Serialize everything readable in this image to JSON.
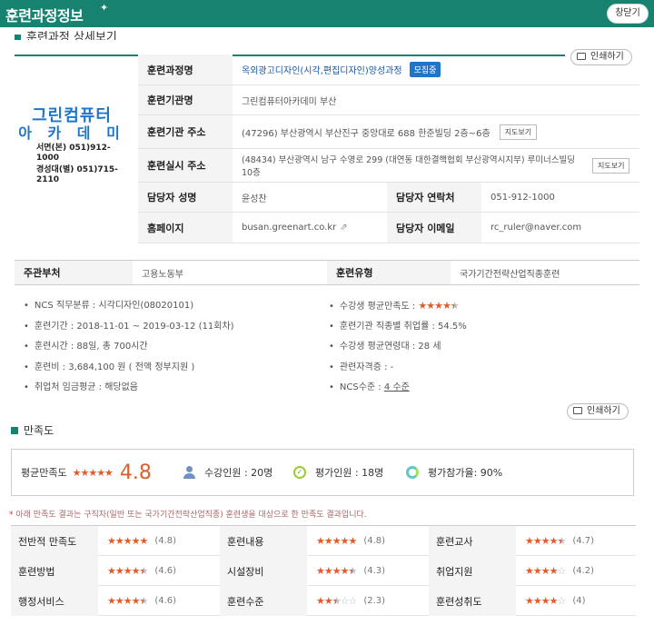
{
  "header": {
    "title": "훈련과정정보",
    "close_label": "창닫기"
  },
  "subheading": "훈련과정 상세보기",
  "print_label": "인쇄하기",
  "institution_logo": {
    "name_line1": "그린컴퓨터",
    "name_line2": "아 카 데 미",
    "phone1": "서면(본) 051)912-1000",
    "phone2": "경성대(별) 051)715-2110"
  },
  "details": {
    "course_name_label": "훈련과정명",
    "course_name": "옥외광고디자인(시각,편집디자인)양성과정",
    "status_badge": "모집중",
    "institution_label": "훈련기관명",
    "institution": "그린컴퓨터아카데미 부산",
    "inst_address_label": "훈련기관 주소",
    "inst_address": "(47296) 부산광역시 부산진구 중앙대로 688 한준빌딩 2층~6층",
    "map_label": "지도보기",
    "site_address_label": "훈련실시 주소",
    "site_address": "(48434) 부산광역시 남구 수영로 299 (대연동 대한결핵협회 부산광역시지부) 루미너스빌딩 10층",
    "manager_label": "담당자 성명",
    "manager": "윤성찬",
    "contact_label": "담당자 연락처",
    "contact": "051-912-1000",
    "homepage_label": "홈페이지",
    "homepage": "busan.greenart.co.kr",
    "email_label": "담당자 이메일",
    "email": "rc_ruler@naver.com"
  },
  "summary_row": {
    "ministry_label": "주관부처",
    "ministry": "고용노동부",
    "type_label": "훈련유형",
    "type": "국가기간전략산업직종훈련"
  },
  "info_left": [
    {
      "text": "NCS 직무분류 : 시각디자인(08020101)"
    },
    {
      "text": "훈련기간 : 2018-11-01 ~ 2019-03-12 (11회차)"
    },
    {
      "text": "훈련시간 : 88일, 총 700시간"
    },
    {
      "text": "훈련비 : 3,684,100 원 ( 전액 정부지원 )"
    },
    {
      "text": "취업처 임금평균 : 해당없음"
    }
  ],
  "info_right": {
    "rating_label": "수강생 평균만족도 :",
    "rating_stars": 4.5,
    "employment": "훈련기관 직종별 취업률 : 54.5%",
    "age": "수강생 평균연령대 : 28 세",
    "cert": "관련자격증 : -",
    "ncs_label": "NCS수준 : ",
    "ncs_link": "4 수준"
  },
  "satisfaction": {
    "title": "만족도",
    "avg_label": "평균만족도",
    "avg_score": "4.8",
    "avg_stars": 4.8,
    "enrolled": "수강인원 : 20명",
    "raters": "평가인원 : 18명",
    "participation": "평가참가율: 90%",
    "note": "아래 만족도 결과는 구직자(일반 또는 국가기간전략산업직종) 훈련생을 대상으로 한 만족도 결과입니다.",
    "note_mark": "*",
    "rows": [
      [
        {
          "label": "전반적 만족도",
          "stars": 4.8,
          "value": "(4.8)"
        },
        {
          "label": "훈련내용",
          "stars": 4.8,
          "value": "(4.8)"
        },
        {
          "label": "훈련교사",
          "stars": 4.7,
          "value": "(4.7)"
        }
      ],
      [
        {
          "label": "훈련방법",
          "stars": 4.6,
          "value": "(4.6)"
        },
        {
          "label": "시설장비",
          "stars": 4.3,
          "value": "(4.3)"
        },
        {
          "label": "취업지원",
          "stars": 4.2,
          "value": "(4.2)"
        }
      ],
      [
        {
          "label": "행정서비스",
          "stars": 4.6,
          "value": "(4.6)"
        },
        {
          "label": "훈련수준",
          "stars": 2.3,
          "value": "(2.3)"
        },
        {
          "label": "훈련성취도",
          "stars": 4,
          "value": "(4)"
        }
      ]
    ]
  }
}
